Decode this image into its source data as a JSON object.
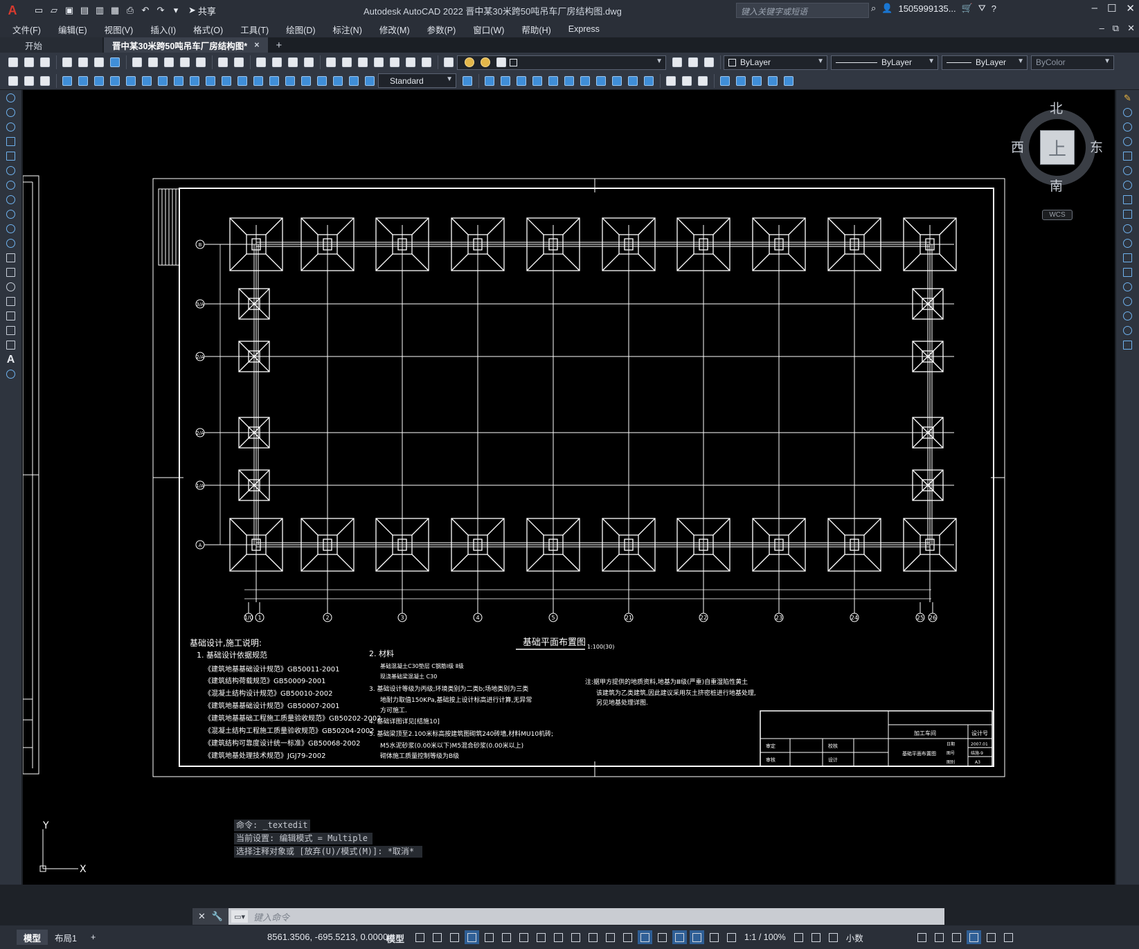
{
  "app": {
    "logo": "A",
    "title": "Autodesk AutoCAD 2022    晋中某30米跨50吨吊车厂房结构图.dwg",
    "share_label": "共享",
    "search_placeholder": "键入关键字或短语",
    "user": "1505999135...",
    "window_controls": [
      "minimize",
      "maximize",
      "close"
    ]
  },
  "menu": {
    "items": [
      "文件(F)",
      "编辑(E)",
      "视图(V)",
      "插入(I)",
      "格式(O)",
      "工具(T)",
      "绘图(D)",
      "标注(N)",
      "修改(M)",
      "参数(P)",
      "窗口(W)",
      "帮助(H)",
      "Express"
    ]
  },
  "tabs": {
    "start": "开始",
    "active": "晋中某30米跨50吨吊车厂房结构图*",
    "close": "×",
    "add": "+"
  },
  "properties": {
    "layer_color": "ByLayer",
    "linetype": "ByLayer",
    "lineweight": "ByLayer",
    "plot_style": "ByColor",
    "text_style": "Standard"
  },
  "viewcube": {
    "north": "北",
    "south": "南",
    "east": "东",
    "west": "西",
    "top": "上",
    "wcs": "WCS"
  },
  "drawing": {
    "plan_title": "基础平面布置图",
    "plan_scale": "1:100(30)",
    "row_axes": [
      "B",
      "3/A",
      "2/A",
      "2/A",
      "1/A",
      "A"
    ],
    "col_axes": [
      "1/0",
      "1",
      "2",
      "3",
      "4",
      "5",
      "21",
      "22",
      "23",
      "24",
      "25",
      "26"
    ],
    "notes_title": "基础设计,施工说明:",
    "notes_left": [
      "1. 基础设计依据规范",
      "《建筑地基基础设计规范》GB50011-2001",
      "《建筑结构荷载规范》GB50009-2001",
      "《混凝土结构设计规范》GB50010-2002",
      "《建筑地基基础设计规范》GB50007-2001",
      "《建筑地基基础工程施工质量验收规范》GB50202-2002",
      "《混凝土结构工程施工质量验收规范》GB50204-2002",
      "《建筑结构可靠度设计统一标准》GB50068-2002",
      "《建筑地基处理技术规范》JGJ79-2002"
    ],
    "notes_mid": [
      "2. 材料",
      "基础混凝土C30垫层 C钢筋Ⅰ级 Ⅱ级",
      "现浇基础梁混凝土 C30",
      "3. 基础设计等级为丙级;环境类别为二类b;场地类别为三类",
      "地耐力取值150KPa,基础按上设计标高进行计算,无异常",
      "方可施工.",
      "4. 基础详图详见[结施10]",
      "5. 基础梁顶至2.100米标高按建筑图砌筑240砖墙,材料MU10机砖;",
      "M5水泥砂浆(0.00米以下)M5混合砂浆(0.00米以上)",
      "砌体施工质量控制等级为B级"
    ],
    "notes_right": [
      "注:据甲方提供的地质资料,地基为Ⅲ级(严重)自重湿陷性黄土",
      "该建筑为乙类建筑,因此建议采用灰土挤密桩进行地基处理,",
      "另见地基处理详图."
    ],
    "titleblock": {
      "company": "加工车间",
      "design_no": "设计号",
      "drawing_name": "基础平面布置图",
      "rows": [
        "审定",
        "审核",
        "校核",
        "设计",
        "日期",
        "图号",
        "图别"
      ],
      "date": "2007.01",
      "drawing_no": "结施-9",
      "sheet": "A3"
    }
  },
  "commands": {
    "history": [
      "命令: _textedit",
      "当前设置: 编辑模式 = Multiple",
      "选择注释对象或 [放弃(U)/模式(M)]: *取消*"
    ],
    "input_placeholder": "键入命令",
    "ucs_x": "X",
    "ucs_y": "Y"
  },
  "status": {
    "layout_tabs": [
      "模型",
      "布局1",
      "+"
    ],
    "coordinates": "8561.3506, -695.5213, 0.0000",
    "space": "模型",
    "scale": "1:1 / 100%",
    "units": "小数"
  }
}
